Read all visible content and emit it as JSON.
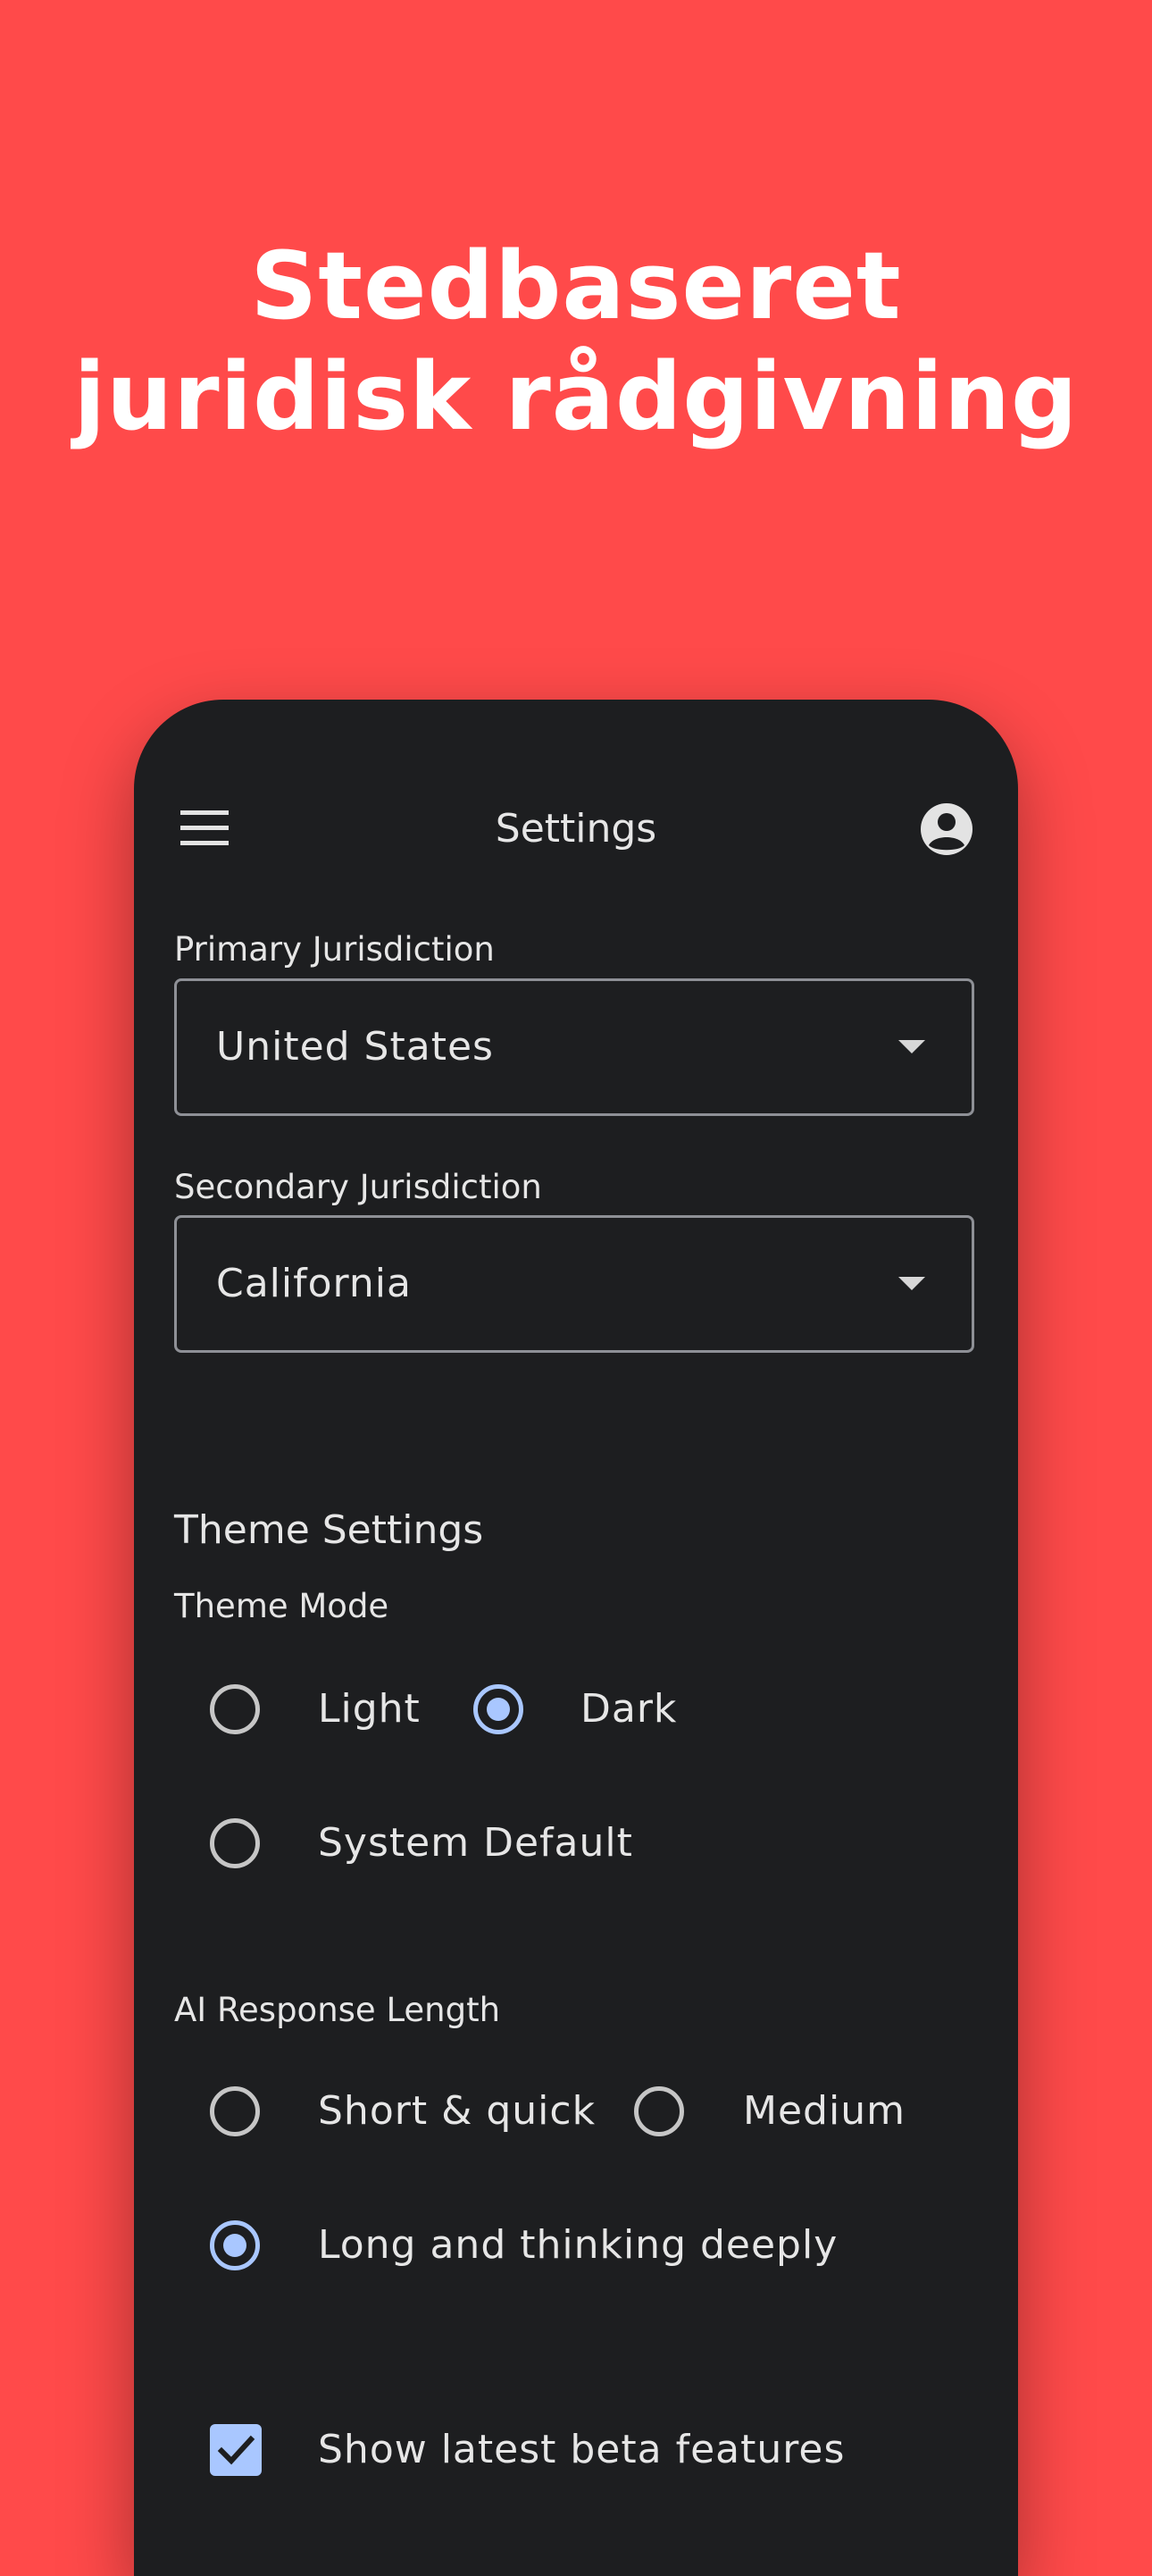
{
  "headline": {
    "line1": "Stedbaseret",
    "line2": "juridisk rådgivning"
  },
  "topbar": {
    "title": "Settings",
    "menu_icon": "menu-icon",
    "account_icon": "account-circle-icon"
  },
  "jurisdiction": {
    "primary_label": "Primary Jurisdiction",
    "primary_value": "United States",
    "secondary_label": "Secondary Jurisdiction",
    "secondary_value": "California"
  },
  "theme": {
    "section_title": "Theme Settings",
    "mode_label": "Theme Mode",
    "options": [
      "Light",
      "Dark",
      "System Default"
    ],
    "selected": "Dark"
  },
  "response_length": {
    "label": "AI Response Length",
    "options": [
      "Short & quick",
      "Medium",
      "Long and thinking deeply"
    ],
    "selected": "Long and thinking deeply"
  },
  "beta": {
    "label": "Show latest beta features",
    "checked": true
  },
  "colors": {
    "background": "#FF4A4A",
    "surface": "#1D1E20",
    "accent": "#A9C7FF"
  }
}
